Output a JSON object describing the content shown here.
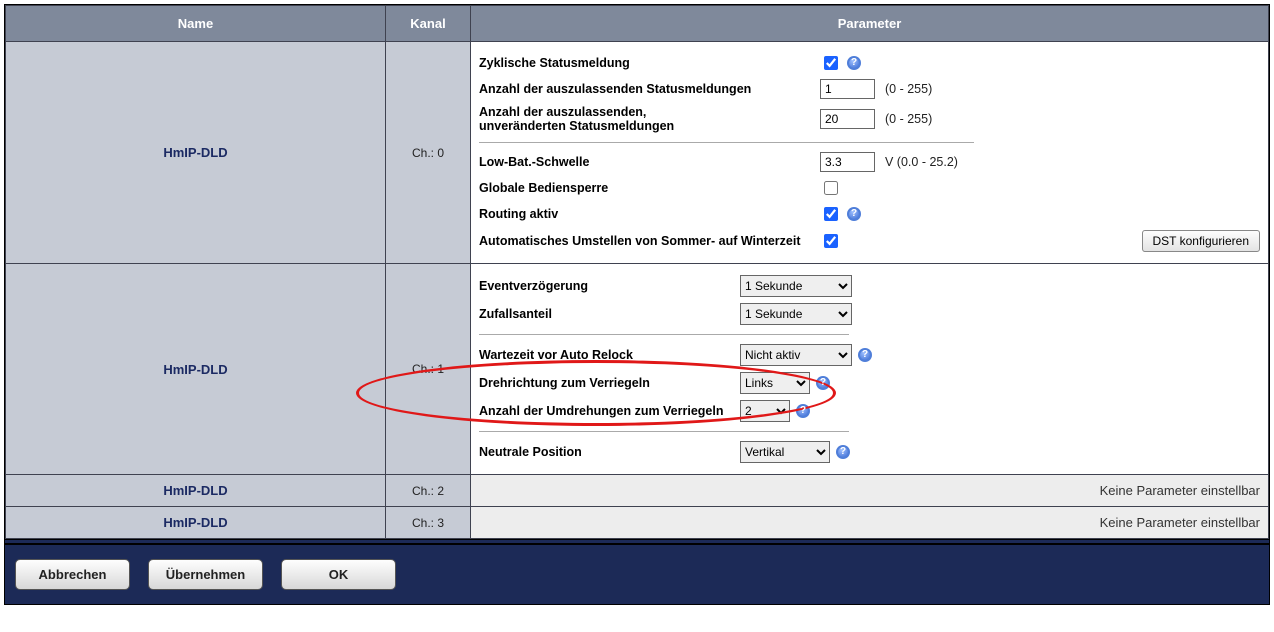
{
  "headers": {
    "name": "Name",
    "kanal": "Kanal",
    "parameter": "Parameter"
  },
  "rows": [
    {
      "name": "HmIP-DLD",
      "kanal": "Ch.: 0",
      "params": {
        "cyclic_label": "Zyklische Statusmeldung",
        "cyclic_checked": true,
        "skip_label": "Anzahl der auszulassenden Statusmeldungen",
        "skip_value": "1",
        "skip_hint": "(0 - 255)",
        "skip_unch_label": "Anzahl der auszulassenden,\nunveränderten Statusmeldungen",
        "skip_unch_value": "20",
        "skip_unch_hint": "(0 - 255)",
        "lowbat_label": "Low-Bat.-Schwelle",
        "lowbat_value": "3.3",
        "lowbat_hint": "V (0.0 - 25.2)",
        "lock_label": "Globale Bediensperre",
        "lock_checked": false,
        "routing_label": "Routing aktiv",
        "routing_checked": true,
        "dst_label": "Automatisches Umstellen von Sommer- auf Winterzeit",
        "dst_checked": true,
        "dst_btn": "DST konfigurieren"
      }
    },
    {
      "name": "HmIP-DLD",
      "kanal": "Ch.: 1",
      "params": {
        "event_label": "Eventverzögerung",
        "event_value": "1 Sekunde",
        "rand_label": "Zufallsanteil",
        "rand_value": "1 Sekunde",
        "wait_label": "Wartezeit vor Auto Relock",
        "wait_value": "Nicht aktiv",
        "dir_label": "Drehrichtung zum Verriegeln",
        "dir_value": "Links",
        "turns_label": "Anzahl der Umdrehungen zum Verriegeln",
        "turns_value": "2",
        "neutral_label": "Neutrale Position",
        "neutral_value": "Vertikal"
      }
    },
    {
      "name": "HmIP-DLD",
      "kanal": "Ch.: 2",
      "noparam": "Keine Parameter einstellbar"
    },
    {
      "name": "HmIP-DLD",
      "kanal": "Ch.: 3",
      "noparam": "Keine Parameter einstellbar"
    }
  ],
  "footer": {
    "cancel": "Abbrechen",
    "apply": "Übernehmen",
    "ok": "OK"
  }
}
